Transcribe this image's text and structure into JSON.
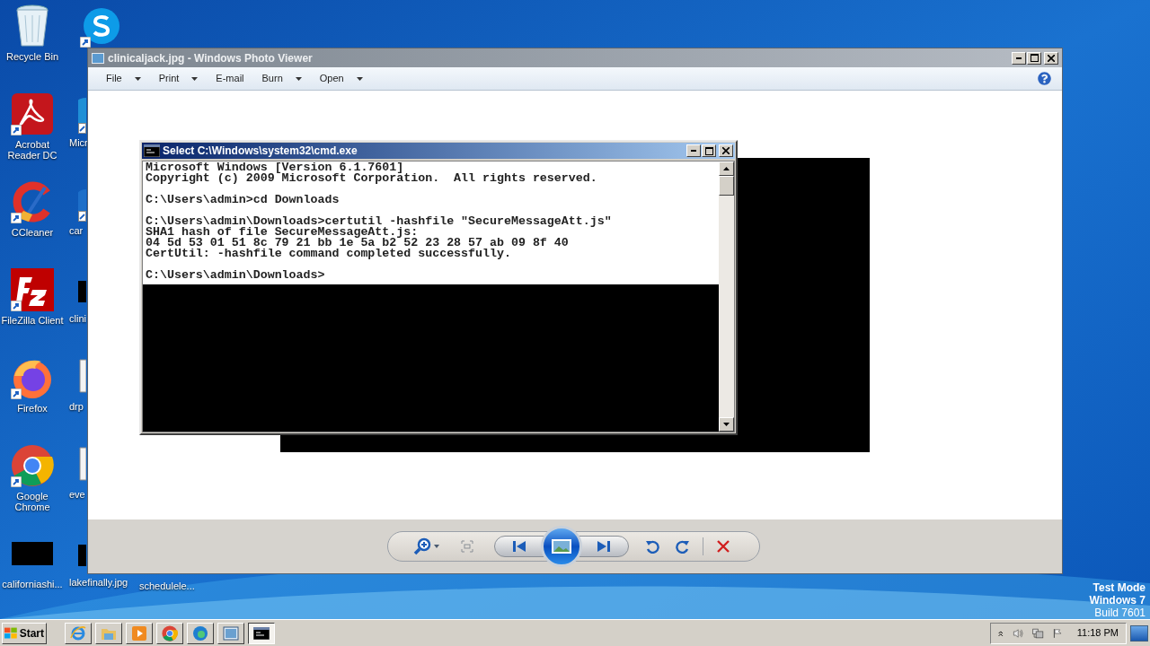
{
  "desktop_icons": {
    "column_1": [
      {
        "label": "Recycle Bin",
        "kind": "recycle",
        "shortcut": false
      },
      {
        "label": "Acrobat Reader DC",
        "kind": "acrobat",
        "shortcut": true
      },
      {
        "label": "CCleaner",
        "kind": "ccleaner",
        "shortcut": true
      },
      {
        "label": "FileZilla Client",
        "kind": "filezilla",
        "shortcut": true
      },
      {
        "label": "Firefox",
        "kind": "firefox",
        "shortcut": true
      },
      {
        "label": "Google Chrome",
        "kind": "chrome",
        "shortcut": true
      },
      {
        "label": "californiashi...",
        "kind": "thumbnail",
        "shortcut": false
      }
    ],
    "column_2": [
      {
        "kind": "skype",
        "shortcut": true
      },
      {
        "label": "Micr",
        "kind": "edge",
        "shortcut": true
      },
      {
        "label": "car",
        "kind": "generic",
        "shortcut": true
      },
      {
        "label": "clini",
        "kind": "thumbnail",
        "shortcut": false
      },
      {
        "label": "drp",
        "kind": "file",
        "shortcut": false
      },
      {
        "label": "eve",
        "kind": "file",
        "shortcut": false
      },
      {
        "label": "lakefinally.jpg",
        "kind": "thumbnail",
        "shortcut": false
      }
    ],
    "column_3": [
      {
        "label": "schedulele..."
      }
    ]
  },
  "photo_viewer": {
    "title": "clinicaljack.jpg - Windows Photo Viewer",
    "menu": [
      {
        "label": "File",
        "dropdown": true
      },
      {
        "label": "Print",
        "dropdown": true
      },
      {
        "label": "E-mail",
        "dropdown": false
      },
      {
        "label": "Burn",
        "dropdown": true
      },
      {
        "label": "Open",
        "dropdown": true
      }
    ],
    "controls": [
      {
        "kind": "zoom"
      },
      {
        "kind": "fit"
      },
      {
        "kind": "previous"
      },
      {
        "kind": "slideshow"
      },
      {
        "kind": "next"
      },
      {
        "kind": "rotate-left"
      },
      {
        "kind": "rotate-right"
      },
      {
        "kind": "separator"
      },
      {
        "kind": "delete"
      }
    ]
  },
  "cmd": {
    "title": "Select C:\\Windows\\system32\\cmd.exe",
    "blocks": [
      [
        "Microsoft Windows [Version 6.1.7601]",
        "Copyright (c) 2009 Microsoft Corporation.  All rights reserved."
      ],
      [
        "C:\\Users\\admin>cd Downloads"
      ],
      [
        "C:\\Users\\admin\\Downloads>certutil -hashfile \"SecureMessageAtt.js\"",
        "SHA1 hash of file SecureMessageAtt.js:",
        "04 5d 53 01 51 8c 79 21 bb 1e 5a b2 52 23 28 57 ab 09 8f 40",
        "CertUtil: -hashfile command completed successfully."
      ],
      [
        "C:\\Users\\admin\\Downloads>"
      ]
    ]
  },
  "os_notice": [
    {
      "text": "Test Mode",
      "bold": true
    },
    {
      "text": "Windows 7",
      "bold": true
    },
    {
      "text": "Build 7601",
      "bold": false
    }
  ],
  "taskbar": {
    "start": "Start",
    "apps": [
      {
        "kind": "ie",
        "selected": false
      },
      {
        "kind": "explorer",
        "selected": false
      },
      {
        "kind": "media",
        "selected": false
      },
      {
        "kind": "chrome",
        "selected": false
      },
      {
        "kind": "edge",
        "selected": false
      },
      {
        "kind": "photos",
        "selected": false
      },
      {
        "kind": "cmd",
        "selected": true
      }
    ],
    "tray": [
      {
        "kind": "chevron"
      },
      {
        "kind": "speaker"
      },
      {
        "kind": "network"
      },
      {
        "kind": "flag"
      }
    ],
    "clock": "11:18 PM"
  }
}
